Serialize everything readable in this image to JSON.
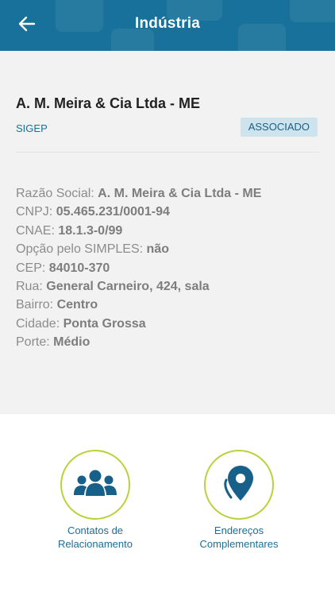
{
  "header": {
    "title": "Indústria"
  },
  "company": {
    "name": "A. M. Meira & Cia Ltda - ME",
    "org": "SIGEP",
    "status_badge": "ASSOCIADO"
  },
  "details": [
    {
      "label": "Razão Social:",
      "value": "A. M. Meira & Cia Ltda - ME"
    },
    {
      "label": "CNPJ:",
      "value": "05.465.231/0001-94"
    },
    {
      "label": "CNAE:",
      "value": "18.1.3-0/99"
    },
    {
      "label": "Opção pelo SIMPLES:",
      "value": "não"
    },
    {
      "label": "CEP:",
      "value": "84010-370"
    },
    {
      "label": "Rua:",
      "value": "General Carneiro, 424, sala"
    },
    {
      "label": "Bairro:",
      "value": "Centro"
    },
    {
      "label": "Cidade:",
      "value": "Ponta Grossa"
    },
    {
      "label": "Porte:",
      "value": "Médio"
    }
  ],
  "actions": {
    "contacts": {
      "line1": "Contatos de",
      "line2": "Relacionamento",
      "icon": "users-icon"
    },
    "addresses": {
      "line1": "Endereços",
      "line2": "Complementares",
      "icon": "map-pin-icon"
    }
  },
  "colors": {
    "header_bg": "#17719a",
    "accent_text": "#1c6f98",
    "badge_bg": "#cde4ef",
    "circle_border": "#b9d23a",
    "icon_color": "#17608a"
  }
}
